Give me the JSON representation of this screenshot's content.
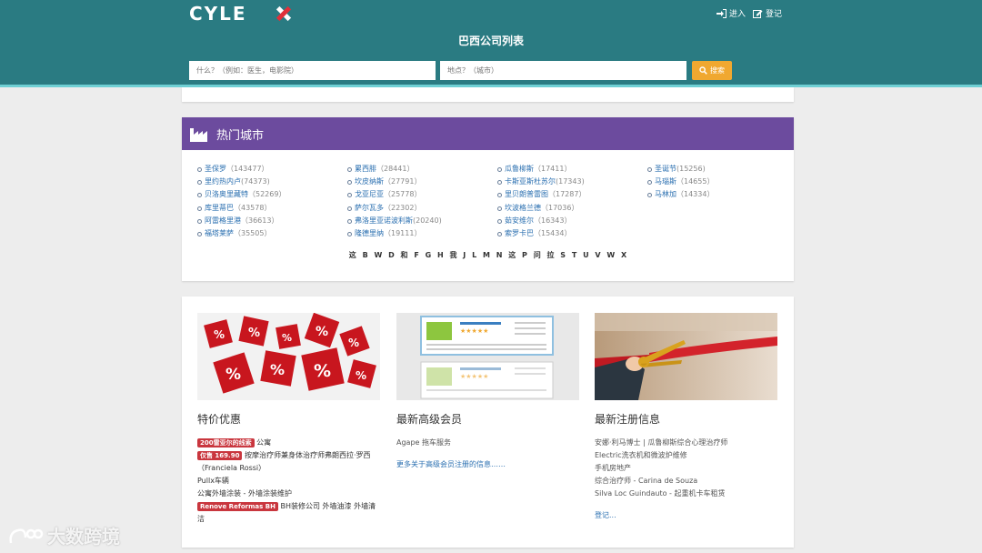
{
  "header": {
    "logo": "CYLEX",
    "login": "进入",
    "register": "登记",
    "title": "巴西公司列表",
    "search_what_placeholder": "什么？（例如：医生，电影院）",
    "search_where_placeholder": "地点？（城市）",
    "search_button": "搜索"
  },
  "cities": {
    "title": "热门城市",
    "columns": [
      [
        {
          "name": "圣保罗",
          "count": "（143477）"
        },
        {
          "name": "里约热内卢",
          "count": "(74373)"
        },
        {
          "name": "贝洛奥里藏特",
          "count": "（52269）"
        },
        {
          "name": "库里蒂巴",
          "count": "（43578）"
        },
        {
          "name": "阿雷格里港",
          "count": "（36613）"
        },
        {
          "name": "福塔莱萨",
          "count": "（35505）"
        }
      ],
      [
        {
          "name": "累西腓",
          "count": "（28441）"
        },
        {
          "name": "坎皮纳斯",
          "count": "（27791）"
        },
        {
          "name": "戈亚尼亚",
          "count": "（25778）"
        },
        {
          "name": "萨尔瓦多",
          "count": "（22302）"
        },
        {
          "name": "弗洛里亚诺波利斯",
          "count": "(20240)"
        },
        {
          "name": "隆德里纳",
          "count": "（19111）"
        }
      ],
      [
        {
          "name": "瓜鲁柳斯",
          "count": "（17411）"
        },
        {
          "name": "卡斯亚斯杜苏尔",
          "count": "(17343)"
        },
        {
          "name": "里贝朗普雷图",
          "count": "（17287）"
        },
        {
          "name": "坎波格兰德",
          "count": "（17036）"
        },
        {
          "name": "茹安维尔",
          "count": "（16343）"
        },
        {
          "name": "索罗卡巴",
          "count": "（15434）"
        }
      ],
      [
        {
          "name": "圣诞节",
          "count": "(15256)"
        },
        {
          "name": "马瑙斯",
          "count": "（14655）"
        },
        {
          "name": "马林加",
          "count": "（14334）"
        }
      ]
    ],
    "alphabet": [
      "这",
      "B",
      "W",
      "D",
      "和",
      "F",
      "G",
      "H",
      "我",
      "J",
      "L",
      "M",
      "N",
      "这",
      "P",
      "问",
      "拉",
      "S",
      "T",
      "U",
      "V",
      "W",
      "X"
    ]
  },
  "deals": {
    "title": "特价优惠",
    "badge1": "200雷亚尔的线索",
    "item1": "公寓",
    "badge2": "仅售 169.90",
    "item2": "按摩治疗师兼身体治疗师弗朗西拉·罗西",
    "item2b": "（Franciela Rossi）",
    "item3": "Pullx车辆",
    "item4": "公寓外墙涂装 - 外墙涂装维护",
    "badge5": "Renove Reformas BH",
    "item5": "BH装修公司 外墙油漆 外墙清洁"
  },
  "premium": {
    "title": "最新高级会员",
    "item1": "Agape 拖车服务",
    "more": "更多关于高级会员注册的信息……"
  },
  "registrations": {
    "title": "最新注册信息",
    "items": [
      "安娜·利马博士 | 瓜鲁柳斯综合心理治疗师",
      "Electric洗衣机和微波炉维修",
      "手机房地产",
      "综合治疗师 - Carina de Souza",
      "Silva Loc Guindauto - 起重机卡车租赁"
    ],
    "more": "登记..."
  },
  "watermark": "大数跨境",
  "colors": {
    "header": "#2a7b82",
    "accent_line": "#6fd0d4",
    "cities_header": "#6c4b9e",
    "search_button": "#f0a830",
    "badge": "#c9363e",
    "link": "#2a6fb0"
  }
}
